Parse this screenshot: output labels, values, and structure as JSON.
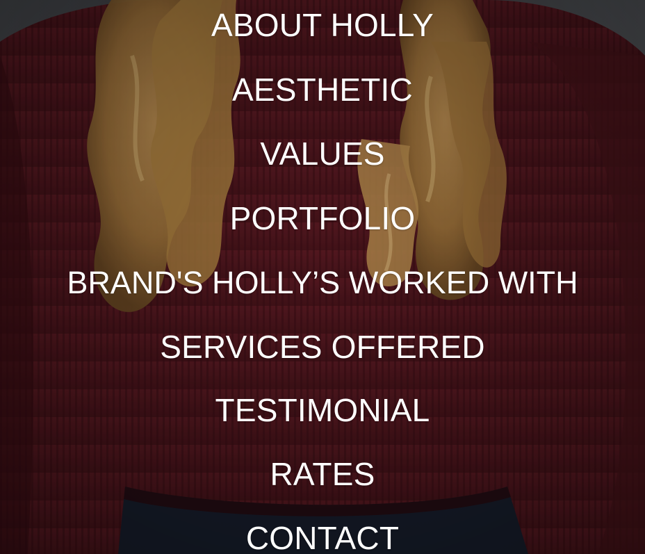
{
  "nav": {
    "items": [
      {
        "label": "ABOUT HOLLY"
      },
      {
        "label": "AESTHETIC"
      },
      {
        "label": "VALUES"
      },
      {
        "label": "PORTFOLIO"
      },
      {
        "label": "BRAND'S  HOLLY’S WORKED WITH"
      },
      {
        "label": "SERVICES OFFERED"
      },
      {
        "label": "TESTIMONIAL"
      },
      {
        "label": "RATES"
      },
      {
        "label": "CONTACT"
      }
    ]
  },
  "colors": {
    "menu_text": "#ffffff",
    "sweater": "#5a1a22",
    "hair": "#b88a4a",
    "background": "#3a3c40"
  }
}
